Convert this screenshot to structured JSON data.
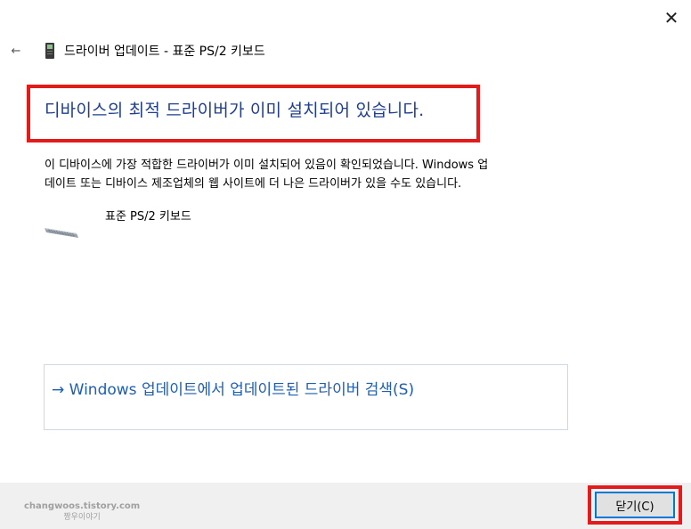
{
  "window": {
    "title": "드라이버 업데이트 - 표준 PS/2 키보드",
    "close_symbol": "✕",
    "back_symbol": "←"
  },
  "main": {
    "heading": "디바이스의 최적 드라이버가 이미 설치되어 있습니다.",
    "description_line1": "이 디바이스에 가장 적합한 드라이버가 이미 설치되어 있음이 확인되었습니다. Windows 업",
    "description_line2": "데이트 또는 디바이스 제조업체의 웹 사이트에 더 나은 드라이버가 있을 수도 있습니다.",
    "device_name": "표준 PS/2 키보드",
    "update_link": "→ Windows 업데이트에서 업데이트된 드라이버 검색(S)"
  },
  "footer": {
    "close_button_label": "닫기(C)",
    "watermark_line1": "changwoos.tistory.com",
    "watermark_line2": "짱우이야기"
  },
  "colors": {
    "heading": "#1f3e8c",
    "link": "#1e5fb0",
    "highlight": "#e41b1b",
    "focus_border": "#0078d7"
  },
  "icons": {
    "close": "close-icon",
    "back": "back-arrow-icon",
    "device_small": "device-icon",
    "keyboard": "keyboard-icon"
  }
}
